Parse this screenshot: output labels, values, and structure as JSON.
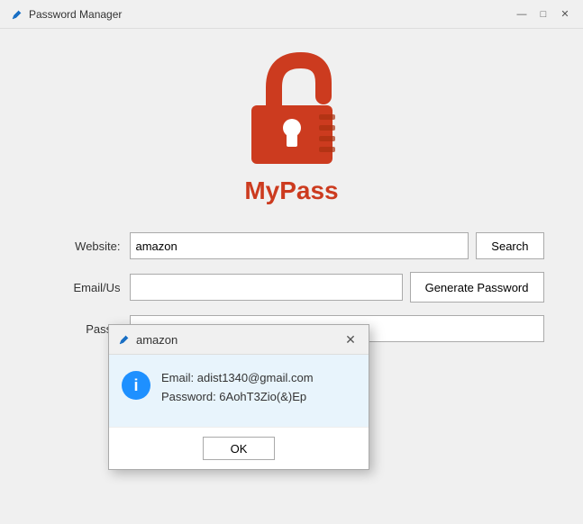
{
  "window": {
    "title": "Password Manager",
    "controls": {
      "minimize": "—",
      "maximize": "□",
      "close": "✕"
    }
  },
  "brand": {
    "name": "MyPass"
  },
  "form": {
    "website_label": "Website:",
    "website_value": "amazon",
    "email_label": "Email/Us",
    "password_label": "Passw",
    "search_btn": "Search",
    "generate_btn": "Generate Password"
  },
  "dialog": {
    "title": "amazon",
    "email_line": "Email: adist1340@gmail.com",
    "password_line": "Password: 6AohT3Zio(&)Ep",
    "ok_btn": "OK"
  },
  "colors": {
    "brand_red": "#cc3b1f",
    "info_blue": "#1e90ff"
  }
}
